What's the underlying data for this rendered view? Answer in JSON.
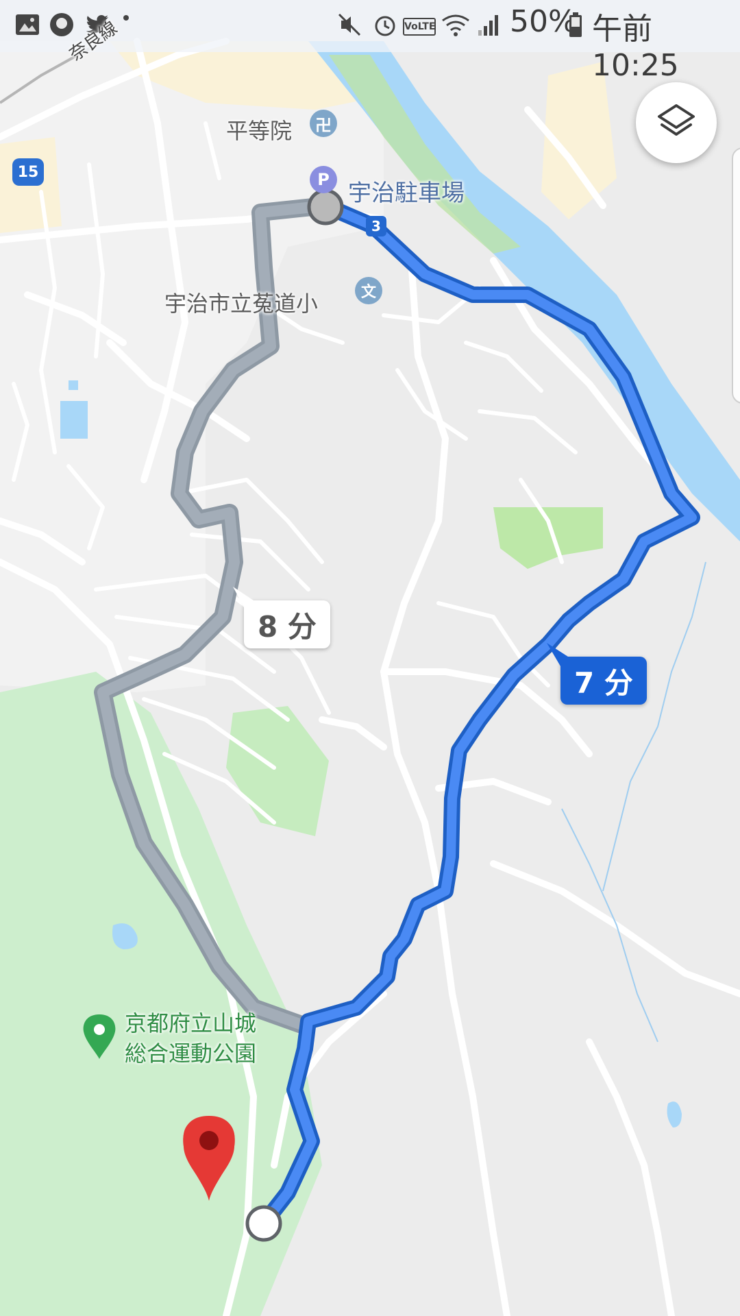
{
  "status_bar": {
    "battery": "50%",
    "time": "午前 10:25",
    "icons": [
      "image-icon",
      "avatar-icon",
      "twitter-icon",
      "mute-icon",
      "alarm-icon",
      "volte-icon",
      "wifi-icon",
      "signal-icon",
      "battery-icon"
    ]
  },
  "map": {
    "labels": {
      "byodoin": "平等院",
      "uji_parking": "宇治駐車場",
      "school": "宇治市立菟道小",
      "park_line1": "京都府立山城",
      "park_line2": "総合運動公園",
      "rail_line": "奈良線"
    },
    "shields": {
      "route_15": "15",
      "route_3": "3"
    },
    "poi_glyphs": {
      "temple": "卍",
      "parking": "P",
      "school": "文"
    },
    "route_times": {
      "alternate": "8 分",
      "selected": "7 分"
    },
    "colors": {
      "selected_route": "#4a8af4",
      "alternate_route": "#a3adb8",
      "river": "#a8d7f8",
      "park": "#c9efc9",
      "pin": "#e53935"
    }
  },
  "controls": {
    "layers_button": "layers-icon"
  }
}
